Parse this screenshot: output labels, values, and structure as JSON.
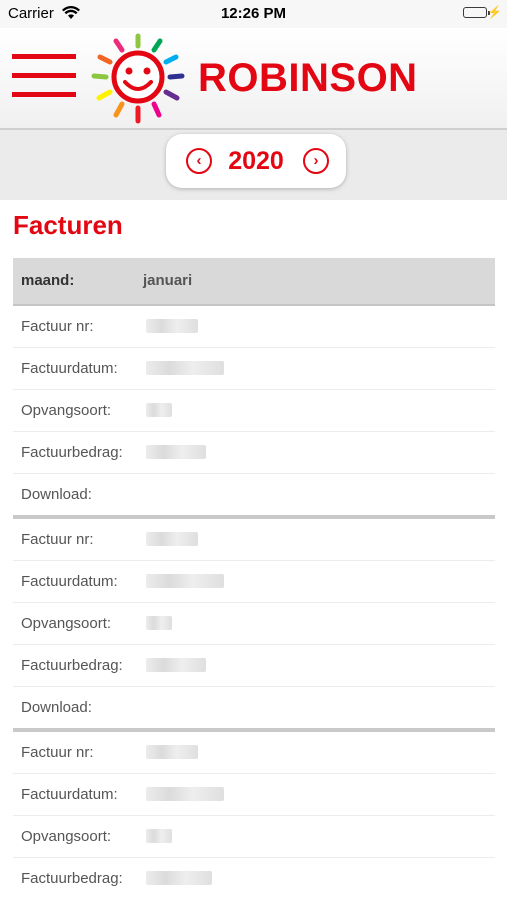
{
  "status_bar": {
    "carrier": "Carrier",
    "time": "12:26 PM",
    "battery_level": 1.0
  },
  "header": {
    "menu_icon": "hamburger-menu-icon",
    "logo_text": "ROBINSON",
    "brand_color": "#e30613"
  },
  "year_selector": {
    "year": "2020",
    "prev_icon": "chevron-left-circle-icon",
    "next_icon": "chevron-right-circle-icon"
  },
  "page_title": "Facturen",
  "table": {
    "header_key": "maand:",
    "header_value": "januari",
    "groups": [
      {
        "rows": [
          {
            "label": "Factuur nr:"
          },
          {
            "label": "Factuurdatum:"
          },
          {
            "label": "Opvangsoort:"
          },
          {
            "label": "Factuurbedrag:"
          },
          {
            "label": "Download:"
          }
        ]
      },
      {
        "rows": [
          {
            "label": "Factuur nr:"
          },
          {
            "label": "Factuurdatum:"
          },
          {
            "label": "Opvangsoort:"
          },
          {
            "label": "Factuurbedrag:"
          },
          {
            "label": "Download:"
          }
        ]
      },
      {
        "rows": [
          {
            "label": "Factuur nr:"
          },
          {
            "label": "Factuurdatum:"
          },
          {
            "label": "Opvangsoort:"
          },
          {
            "label": "Factuurbedrag:"
          }
        ]
      }
    ]
  }
}
